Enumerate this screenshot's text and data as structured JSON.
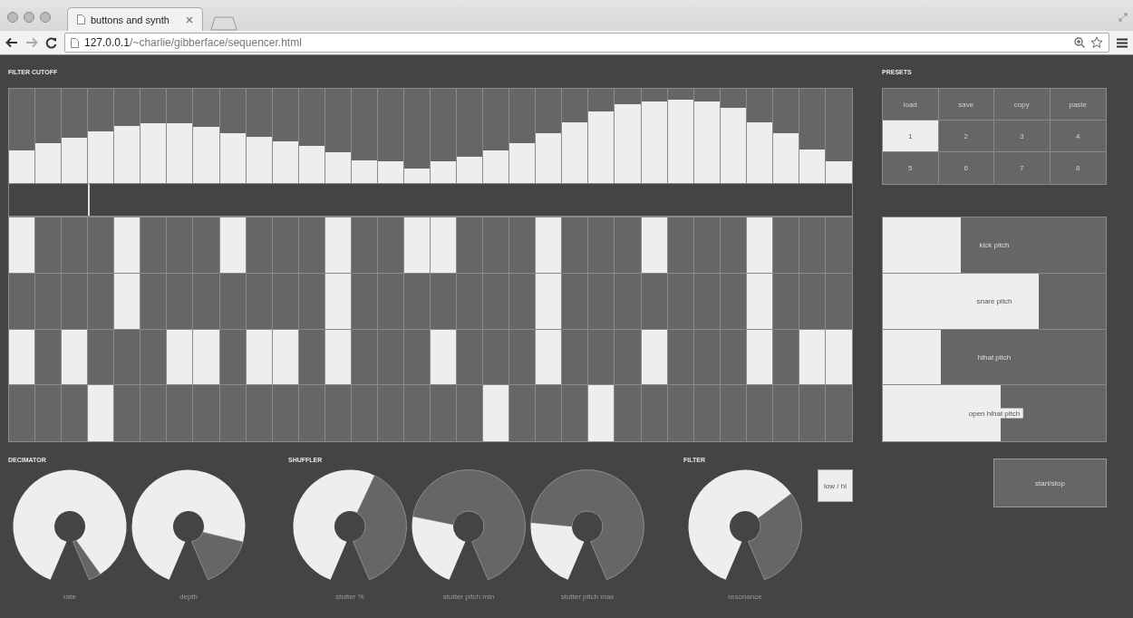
{
  "browser": {
    "tab_title": "buttons and synth",
    "url_host": "127.0.0.1",
    "url_path": "/~charlie/gibberface/sequencer.html"
  },
  "filter_cutoff": {
    "title": "FILTER CUTOFF",
    "steps": [
      {
        "level": 0.35
      },
      {
        "level": 0.42
      },
      {
        "level": 0.48
      },
      {
        "level": 0.55
      },
      {
        "level": 0.61
      },
      {
        "level": 0.63
      },
      {
        "level": 0.63
      },
      {
        "level": 0.6
      },
      {
        "level": 0.53
      },
      {
        "level": 0.49
      },
      {
        "level": 0.44
      },
      {
        "level": 0.39
      },
      {
        "level": 0.33
      },
      {
        "level": 0.24
      },
      {
        "level": 0.23
      },
      {
        "level": 0.15
      },
      {
        "level": 0.23
      },
      {
        "level": 0.28
      },
      {
        "level": 0.35
      },
      {
        "level": 0.42
      },
      {
        "level": 0.53
      },
      {
        "level": 0.64
      },
      {
        "level": 0.76
      },
      {
        "level": 0.84
      },
      {
        "level": 0.87
      },
      {
        "level": 0.88
      },
      {
        "level": 0.87
      },
      {
        "level": 0.8
      },
      {
        "level": 0.64
      },
      {
        "level": 0.53
      },
      {
        "level": 0.36
      },
      {
        "level": 0.23
      }
    ]
  },
  "playhead": {
    "level": 0.094
  },
  "sequencer": {
    "rows": [
      {
        "steps": [
          true,
          false,
          false,
          false,
          true,
          false,
          false,
          false,
          true,
          false,
          false,
          false,
          true,
          false,
          false,
          true,
          true,
          false,
          false,
          false,
          true,
          false,
          false,
          false,
          true,
          false,
          false,
          false,
          true,
          false,
          false,
          false
        ]
      },
      {
        "steps": [
          false,
          false,
          false,
          false,
          true,
          false,
          false,
          false,
          false,
          false,
          false,
          false,
          true,
          false,
          false,
          false,
          false,
          false,
          false,
          false,
          true,
          false,
          false,
          false,
          false,
          false,
          false,
          false,
          true,
          false,
          false,
          false
        ]
      },
      {
        "steps": [
          true,
          false,
          true,
          false,
          false,
          false,
          true,
          true,
          false,
          true,
          true,
          false,
          true,
          false,
          false,
          false,
          true,
          false,
          false,
          false,
          true,
          false,
          false,
          false,
          true,
          false,
          false,
          false,
          true,
          false,
          true,
          true
        ]
      },
      {
        "steps": [
          false,
          false,
          false,
          true,
          false,
          false,
          false,
          false,
          false,
          false,
          false,
          false,
          false,
          false,
          false,
          false,
          false,
          false,
          true,
          false,
          false,
          false,
          true,
          false,
          false,
          false,
          false,
          false,
          false,
          false,
          false,
          false
        ]
      }
    ]
  },
  "presets": {
    "title": "PRESETS",
    "actions": [
      "load",
      "save",
      "copy",
      "paste"
    ],
    "slots": [
      {
        "label": "1",
        "selected": true
      },
      {
        "label": "2",
        "selected": false
      },
      {
        "label": "3",
        "selected": false
      },
      {
        "label": "4",
        "selected": false
      },
      {
        "label": "5",
        "selected": false
      },
      {
        "label": "6",
        "selected": false
      },
      {
        "label": "7",
        "selected": false
      },
      {
        "label": "8",
        "selected": false
      }
    ]
  },
  "pitch_sliders": [
    {
      "label": "kick pitch",
      "level": 0.35
    },
    {
      "label": "snare pitch",
      "level": 0.7
    },
    {
      "label": "hihat pitch",
      "level": 0.26
    },
    {
      "label": "open hihat pitch",
      "level": 0.53
    }
  ],
  "start_button": {
    "label": "start/stop"
  },
  "sections": [
    {
      "title": "DECIMATOR",
      "knobs": [
        {
          "label": "rate"
        },
        {
          "label": "depth"
        }
      ]
    },
    {
      "title": "SHUFFLER",
      "knobs": [
        {
          "label": "stutter %"
        },
        {
          "label": "stutter pitch min"
        },
        {
          "label": "stutter pitch max"
        }
      ]
    },
    {
      "title": "FILTER",
      "knobs": [
        {
          "label": "resonance"
        }
      ],
      "toggle": {
        "label": "low / hi",
        "on": true
      }
    }
  ]
}
